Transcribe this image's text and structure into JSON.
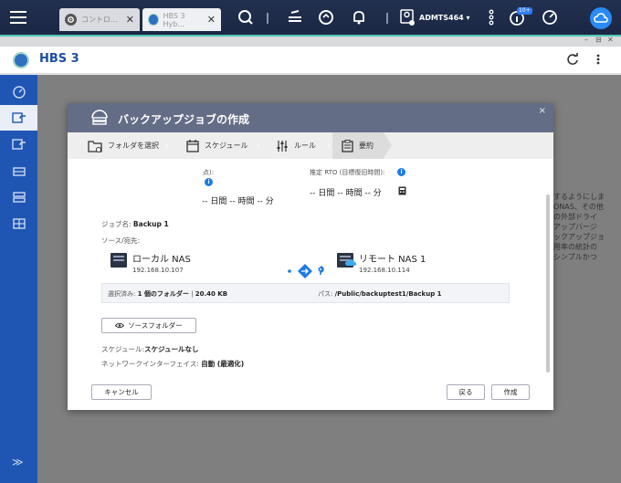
{
  "topbar": {
    "tabs": [
      {
        "label": "コントロ...",
        "close": "✕"
      },
      {
        "label": "HBS 3 Hyb...",
        "close": "✕"
      }
    ],
    "username": "ADMTS464 ▾",
    "notification_badge": "10+"
  },
  "window": {
    "controls": [
      "–",
      "⊟",
      "✕"
    ]
  },
  "app": {
    "title": "HBS 3",
    "refresh_icon": "refresh-icon",
    "more_icon": "more-vertical-icon"
  },
  "sidebar": {
    "expand_label": "≫"
  },
  "background": {
    "text_lines": [
      "するようにしま",
      "ONAS、その他",
      "の外部ドライ",
      "アップバージ",
      "ックアップジョ",
      "用率の統計の",
      "シンプルかつ"
    ]
  },
  "dialog": {
    "title": "バックアップジョブの作成",
    "close": "×",
    "steps": [
      {
        "label": "フォルダを選択",
        "icon": "folder-icon"
      },
      {
        "label": "スケジュール",
        "icon": "calendar-icon"
      },
      {
        "label": "ルール",
        "icon": "sliders-icon"
      },
      {
        "label": "要約",
        "icon": "clipboard-icon"
      }
    ],
    "rpo_left_label": "点):",
    "rpo_left_value": "-- 日間 -- 時間 -- 分",
    "rpo_right_label": "推定 RTO (目標復旧時間):",
    "rpo_right_value": "-- 日間 -- 時間 -- 分",
    "job_name_label": "ジョブ名:",
    "job_name_value": "Backup 1",
    "source_dest_label": "ソース/宛先:",
    "source": {
      "name": "ローカル NAS",
      "ip": "192.168.10.107"
    },
    "destination": {
      "name": "リモート NAS 1",
      "ip": "192.168.10.114"
    },
    "selected_label": "選択済み:",
    "selected_value": "1 個のフォルダー",
    "selected_sep": " | ",
    "selected_size": "20.40 KB",
    "path_label": "パス:",
    "path_value": "/Public/backuptest1/Backup 1",
    "source_folder_button": "ソースフォルダー",
    "schedule_label": "スケジュール:",
    "schedule_value": "スケジュールなし",
    "network_label": "ネットワークインターフェイス:",
    "network_value": "自動 (最適化)",
    "cancel_button": "キャンセル",
    "back_button": "戻る",
    "create_button": "作成"
  },
  "colors": {
    "sidebar": "#1f56b4",
    "dialog_header": "#646d86",
    "accent": "#52c6b8",
    "info": "#1f7be0"
  }
}
